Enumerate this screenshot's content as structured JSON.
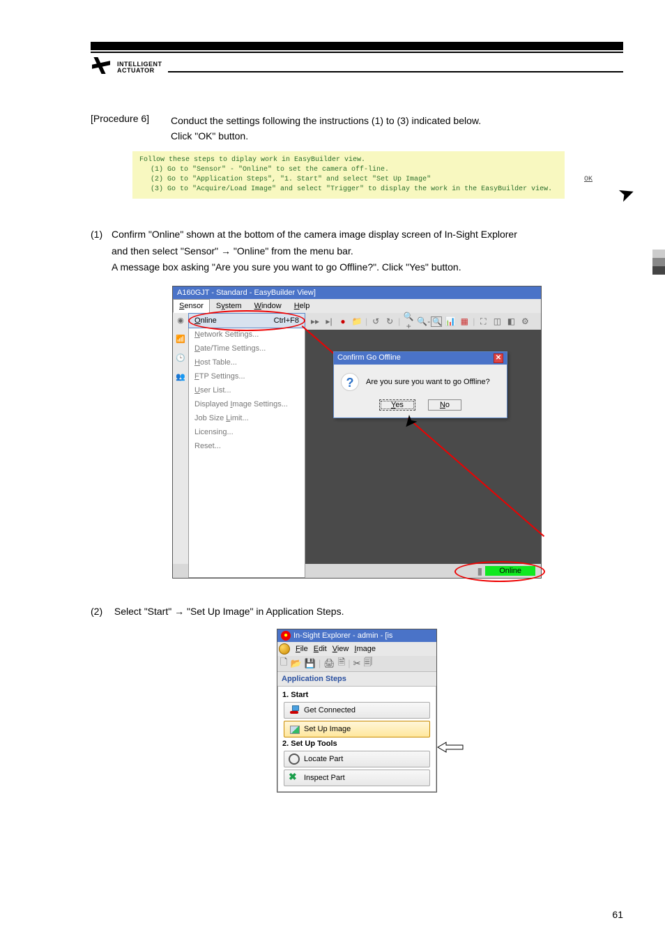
{
  "header": {
    "brand_top": "INTELLIGENT",
    "brand_bottom": "ACTUATOR"
  },
  "procedure6": {
    "label": "[Procedure 6]",
    "line1": "Conduct the settings following the instructions (1) to (3) indicated below.",
    "line2": "Click \"OK\" button."
  },
  "yellowbox": {
    "l0": "Follow these steps to diplay work in EasyBuilder view.",
    "l1": "(1) Go to \"Sensor\" - \"Online\" to set the camera off-line.",
    "l2": "(2) Go to \"Application Steps\", \"1. Start\" and select \"Set Up Image\"",
    "l3": "(3) Go to \"Acquire/Load Image\" and select \"Trigger\" to display the work in the EasyBuilder view.",
    "ok": "OK"
  },
  "para1": {
    "num": "(1)",
    "l1": "Confirm \"Online\" shown at the bottom of the camera image display screen of In-Sight Explorer",
    "l2": "and then select \"Sensor\" → \"Online\" from the menu bar.",
    "l3": "A message box asking \"Are you sure you want to go Offline?\". Click \"Yes\" button."
  },
  "shot1": {
    "title": "A160GJT - Standard - EasyBuilder View]",
    "menus": {
      "sensor": "Sensor",
      "system": "System",
      "window": "Window",
      "help": "Help"
    },
    "online_item": "Online",
    "online_accel": "Ctrl+F8",
    "items": {
      "net": "Network Settings...",
      "dt": "Date/Time Settings...",
      "host": "Host Table...",
      "ftp": "FTP Settings...",
      "user": "User List...",
      "disp": "Displayed Image Settings...",
      "joblim": "Job Size Limit...",
      "lic": "Licensing...",
      "reset": "Reset..."
    },
    "dialog": {
      "title": "Confirm Go Offline",
      "msg": "Are you sure you want to go Offline?",
      "yes": "Yes",
      "no": "No"
    },
    "status_online": "Online"
  },
  "para2": {
    "num": "(2)",
    "text": "Select \"Start\" → \"Set Up Image\" in Application Steps."
  },
  "shot2": {
    "title": "In-Sight Explorer - admin - [is",
    "menus": {
      "file": "File",
      "edit": "Edit",
      "view": "View",
      "image": "Image"
    },
    "heading": "Application Steps",
    "sec1": "1. Start",
    "btn_conn": "Get Connected",
    "btn_setup": "Set Up Image",
    "sec2": "2. Set Up Tools",
    "btn_locate": "Locate Part",
    "btn_inspect": "Inspect Part"
  },
  "pagenum": "61"
}
